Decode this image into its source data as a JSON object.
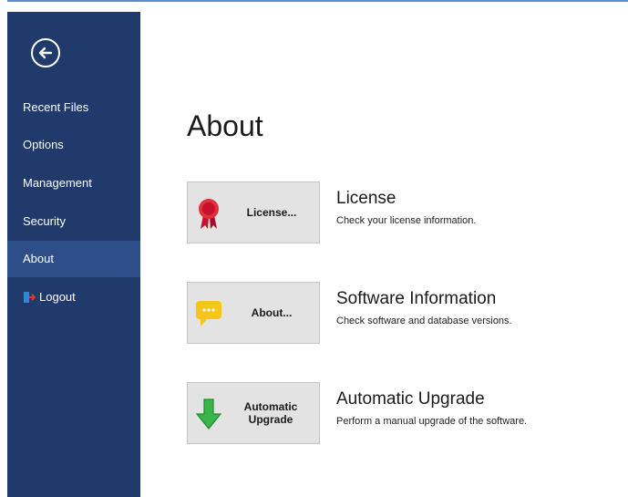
{
  "sidebar": {
    "back_icon": "back-arrow-circle-icon",
    "items": [
      {
        "label": "Recent Files"
      },
      {
        "label": "Options"
      },
      {
        "label": "Management"
      },
      {
        "label": "Security"
      },
      {
        "label": "About",
        "active": true
      },
      {
        "label": "Logout",
        "icon": "logout-door-icon"
      }
    ]
  },
  "main": {
    "title": "About",
    "actions": [
      {
        "button_label": "License...",
        "icon": "ribbon-award-icon",
        "title": "License",
        "description": "Check your license information."
      },
      {
        "button_label": "About...",
        "icon": "speech-bubble-icon",
        "title": "Software Information",
        "description": "Check software and database versions."
      },
      {
        "button_label": "Automatic Upgrade",
        "icon": "green-down-arrow-icon",
        "title": "Automatic Upgrade",
        "description": "Perform a manual upgrade of the software."
      }
    ]
  },
  "colors": {
    "sidebar_bg": "#1f3a6b",
    "sidebar_active": "#2e4e8a",
    "button_bg": "#e3e3e3"
  }
}
